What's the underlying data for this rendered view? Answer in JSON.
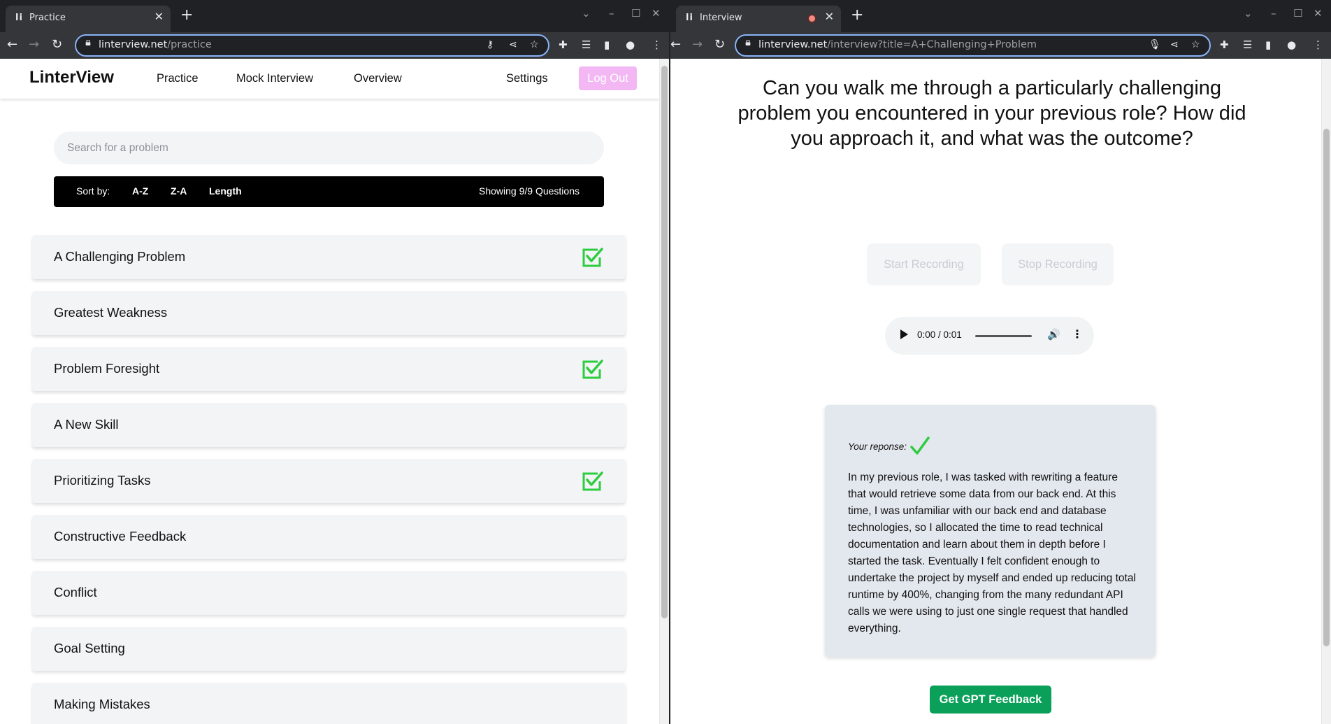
{
  "left_window": {
    "tab": {
      "favicon": "li",
      "title": "Practice",
      "close": "✕"
    },
    "new_tab": "+",
    "window_controls": {
      "dropdown": "⌄",
      "minimize": "–",
      "maximize": "☐",
      "close": "✕"
    },
    "url_host": "linterview.net",
    "url_path": "/practice"
  },
  "right_window": {
    "tab": {
      "favicon": "li",
      "title": "Interview",
      "close": "✕"
    },
    "new_tab": "+",
    "window_controls": {
      "dropdown": "⌄",
      "minimize": "–",
      "maximize": "☐",
      "close": "✕"
    },
    "url_host": "linterview.net",
    "url_path": "/interview?title=A+Challenging+Problem"
  },
  "icons": {
    "back": "←",
    "forward": "→",
    "reload": "↻",
    "key": "⚷",
    "share": "⋖",
    "star": "☆",
    "mic": "🎙",
    "puzzle": "✚",
    "queue": "☰",
    "sidepanel": "▮",
    "profile": "●",
    "menu": "⋮"
  },
  "practice": {
    "brand": "LinterView",
    "nav": {
      "practice": "Practice",
      "mock": "Mock Interview",
      "overview": "Overview",
      "settings": "Settings",
      "logout": "Log Out"
    },
    "search_placeholder": "Search for a problem",
    "sort": {
      "label": "Sort by:",
      "az": "A-Z",
      "za": "Z-A",
      "length": "Length",
      "showing": "Showing 9/9 Questions"
    },
    "questions": [
      {
        "title": "A Challenging Problem",
        "completed": true
      },
      {
        "title": "Greatest Weakness",
        "completed": false
      },
      {
        "title": "Problem Foresight",
        "completed": true
      },
      {
        "title": "A New Skill",
        "completed": false
      },
      {
        "title": "Prioritizing Tasks",
        "completed": true
      },
      {
        "title": "Constructive Feedback",
        "completed": false
      },
      {
        "title": "Conflict",
        "completed": false
      },
      {
        "title": "Goal Setting",
        "completed": false
      },
      {
        "title": "Making Mistakes",
        "completed": false
      }
    ],
    "check_color": "#2ecc40"
  },
  "interview": {
    "question": "Can you walk me through a particularly challenging problem you encountered in your previous role? How did you approach it, and what was the outcome?",
    "start_recording": "Start Recording",
    "stop_recording": "Stop Recording",
    "audio_time": "0:00 / 0:01",
    "response_label": "Your reponse:",
    "response_text": "In my previous role, I was tasked with rewriting a feature that would retrieve some data from our back end. At this time, I was unfamiliar with our back end and database technologies, so I allocated the time to read technical documentation and learn about them in depth before I started the task. Eventually I felt confident enough to undertake the project by myself and ended up reducing total runtime by 400%, changing from the many redundant API calls we were using to just one single request that handled everything.",
    "gpt_button": "Get GPT Feedback",
    "gpt_color": "#0aa05a"
  }
}
